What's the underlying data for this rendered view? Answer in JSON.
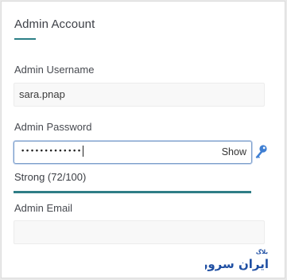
{
  "section": {
    "title": "Admin Account"
  },
  "fields": {
    "username": {
      "label": "Admin Username",
      "value": "sara.pnap"
    },
    "password": {
      "label": "Admin Password",
      "masked_value": "•••••••••••••",
      "show_label": "Show",
      "strength_text": "Strong (72/100)",
      "strength_score": 72,
      "strength_max": 100
    },
    "email": {
      "label": "Admin Email",
      "value": ""
    }
  },
  "icons": {
    "password_generator": "key-icon"
  },
  "colors": {
    "accent": "#2c7f86",
    "focus_border": "#7b9dc9",
    "key_icon": "#3f7fd3",
    "watermark": "#1f4fa3"
  },
  "watermark": {
    "main_text": "ایران سرور",
    "small_text": "بلاگ"
  }
}
